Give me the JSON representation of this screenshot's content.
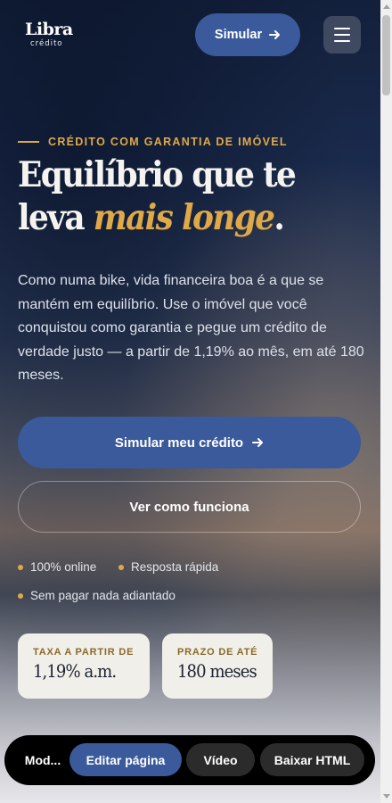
{
  "header": {
    "logo_main": "Libra",
    "logo_sub": "crédito",
    "simulate_label": "Simular",
    "arrow_icon": "arrow-right-icon",
    "menu_icon": "hamburger-menu-icon"
  },
  "hero": {
    "eyebrow": "CRÉDITO COM GARANTIA DE IMÓVEL",
    "headline_line1": "Equilíbrio que te",
    "headline_line2_prefix": "leva ",
    "headline_line2_accent": "mais longe",
    "headline_line2_suffix": ".",
    "lead": "Como numa bike, vida financeira boa é a que se mantém em equilíbrio. Use o imóvel que você conquistou como garantia e pegue um crédito de verdade justo — a partir de 1,19% ao mês, em até 180 meses.",
    "primary_cta": "Simular meu crédito",
    "secondary_cta": "Ver como funciona"
  },
  "features": [
    "100% online",
    "Resposta rápida",
    "Sem pagar nada adiantado"
  ],
  "stats": [
    {
      "label": "TAXA A PARTIR DE",
      "value": "1,19% a.m."
    },
    {
      "label": "PRAZO DE ATÉ",
      "value": "180 meses"
    }
  ],
  "toolbar": {
    "mode": "Mod...",
    "edit": "Editar página",
    "video": "Vídeo",
    "download": "Baixar HTML"
  },
  "colors": {
    "accent": "#e0a948",
    "primary": "#3a5a9c",
    "card_bg": "#f1efe9"
  }
}
